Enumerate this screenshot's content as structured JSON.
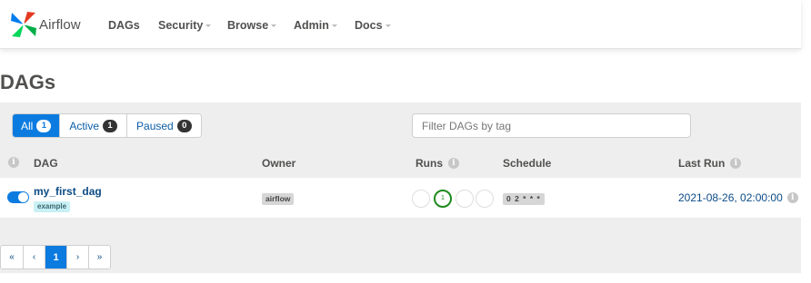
{
  "nav": {
    "brand": "Airflow",
    "items": [
      {
        "label": "DAGs",
        "dropdown": false
      },
      {
        "label": "Security",
        "dropdown": true
      },
      {
        "label": "Browse",
        "dropdown": true
      },
      {
        "label": "Admin",
        "dropdown": true
      },
      {
        "label": "Docs",
        "dropdown": true
      }
    ]
  },
  "page": {
    "title": "DAGs"
  },
  "filters": {
    "all": {
      "label": "All",
      "count": "1"
    },
    "active": {
      "label": "Active",
      "count": "1"
    },
    "paused": {
      "label": "Paused",
      "count": "0"
    },
    "tag_placeholder": "Filter DAGs by tag"
  },
  "table": {
    "info_glyph": "i",
    "headers": {
      "dag": "DAG",
      "owner": "Owner",
      "runs": "Runs",
      "schedule": "Schedule",
      "last_run": "Last Run"
    },
    "rows": [
      {
        "dag_id": "my_first_dag",
        "tag": "example",
        "owner": "airflow",
        "runs_success": "1",
        "schedule": "0 2 * * *",
        "last_run": "2021-08-26, 02:00:00",
        "enabled": true
      }
    ]
  },
  "pagination": {
    "first": "«",
    "prev": "‹",
    "current": "1",
    "next": "›",
    "last": "»"
  },
  "colors": {
    "primary": "#0c7be0",
    "link": "#0b4b86",
    "success": "#1e8a1e",
    "panel_bg": "#eeeeee"
  }
}
